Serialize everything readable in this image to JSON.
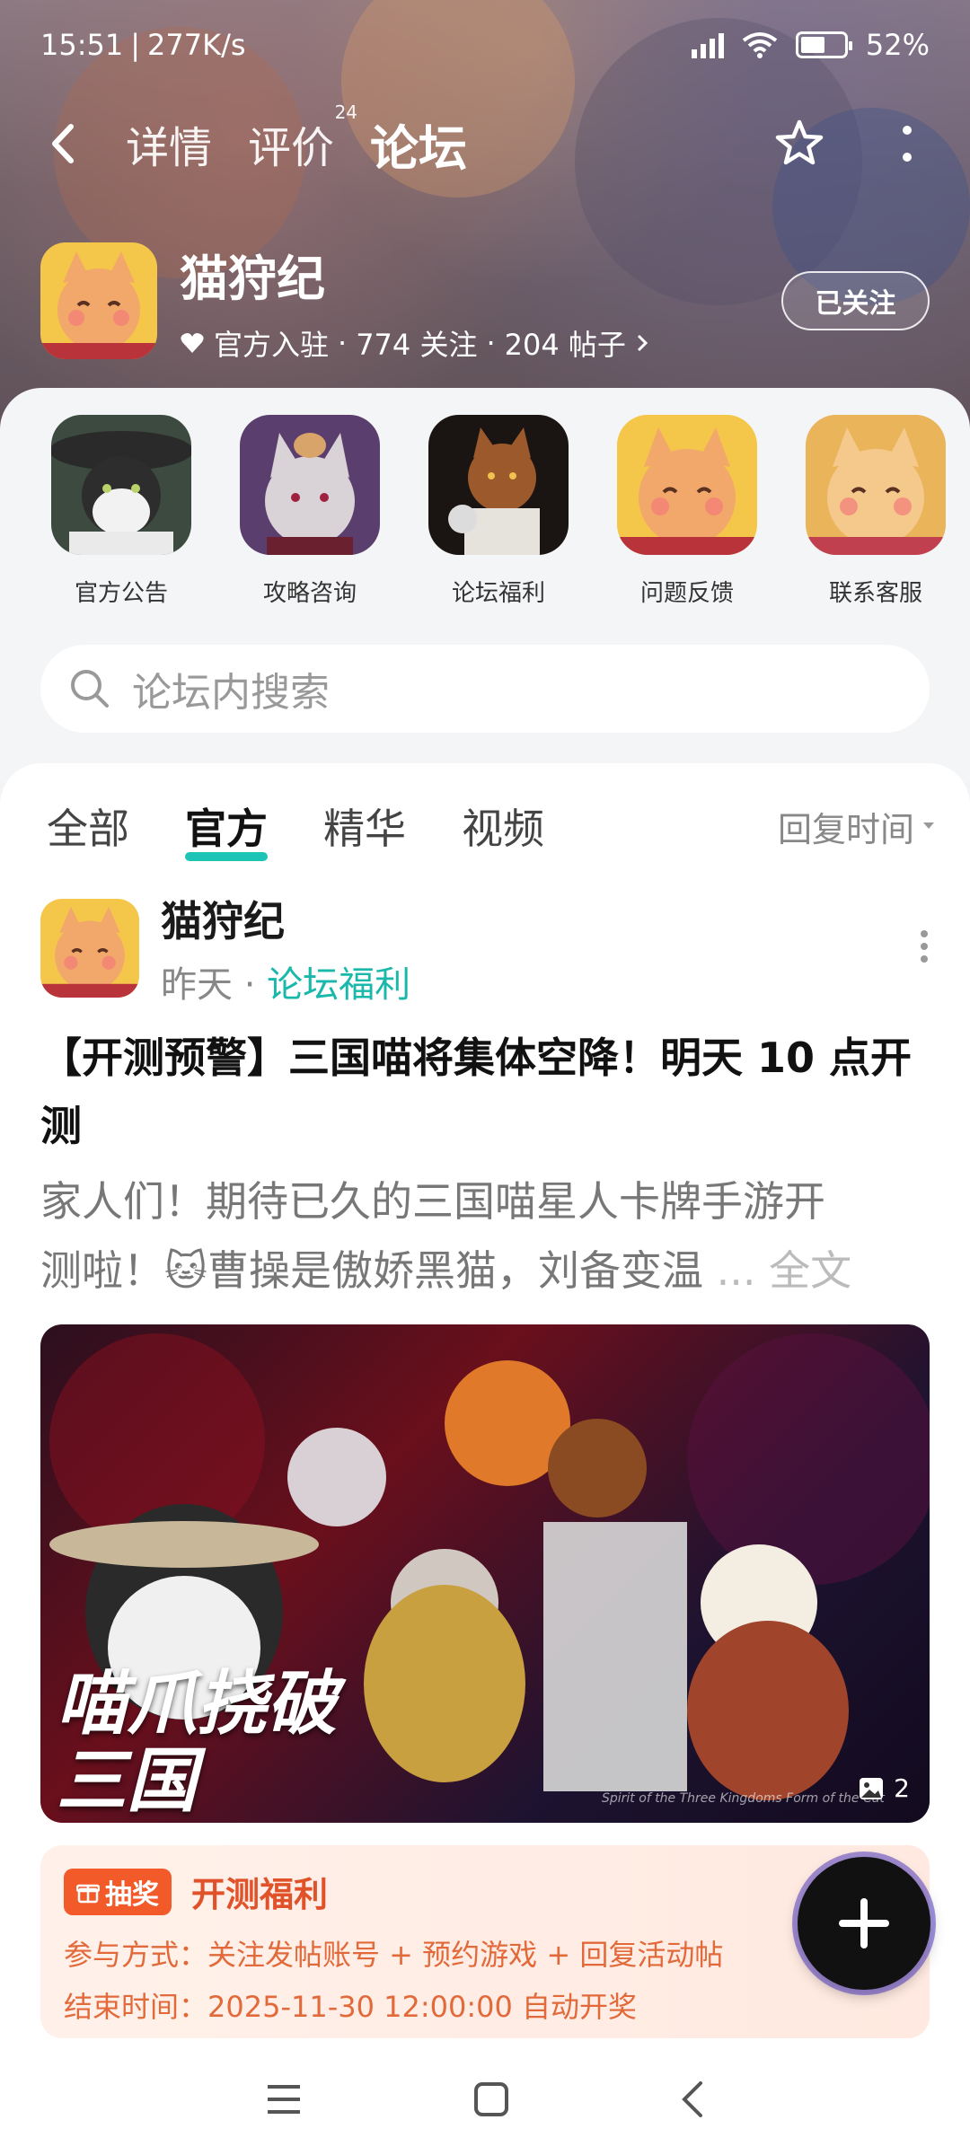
{
  "status_bar": {
    "time": "15:51",
    "speed": "277K/s",
    "battery": "52%"
  },
  "nav": {
    "tabs": [
      {
        "label": "详情"
      },
      {
        "label": "评价",
        "badge": "24"
      },
      {
        "label": "论坛"
      }
    ]
  },
  "game": {
    "name": "猫狩纪",
    "official": "官方入驻",
    "followers": "774 关注",
    "posts": "204 帖子",
    "follow_label": "已关注"
  },
  "categories": [
    {
      "label": "官方公告"
    },
    {
      "label": "攻略咨询"
    },
    {
      "label": "论坛福利"
    },
    {
      "label": "问题反馈"
    },
    {
      "label": "联系客服"
    }
  ],
  "search": {
    "placeholder": "论坛内搜索"
  },
  "feed": {
    "tabs": [
      "全部",
      "官方",
      "精华",
      "视频"
    ],
    "sort_label": "回复时间"
  },
  "post": {
    "author": "猫狩纪",
    "time": "昨天",
    "forum": "论坛福利",
    "title": "【开测预警】三国喵将集体空降！明天 10 点开测",
    "body_line1": "家人们！期待已久的三国喵星人卡牌手游开",
    "body_line2": "测啦！🐱曹操是傲娇黑猫，刘备变温",
    "more": "... 全文",
    "image_text": "喵爪挠破三国",
    "image_caption": "Spirit of the Three Kingdoms Form of the Cat",
    "image_count": "2"
  },
  "lottery": {
    "badge": "抽奖",
    "title": "开测福利",
    "participate": "参与方式：关注发帖账号 + 预约游戏 + 回复活动帖",
    "end_time": "结束时间：2025-11-30 12:00:00 自动开奖"
  },
  "colors": {
    "accent": "#1bc4b5",
    "lottery_orange": "#f35a2a"
  }
}
